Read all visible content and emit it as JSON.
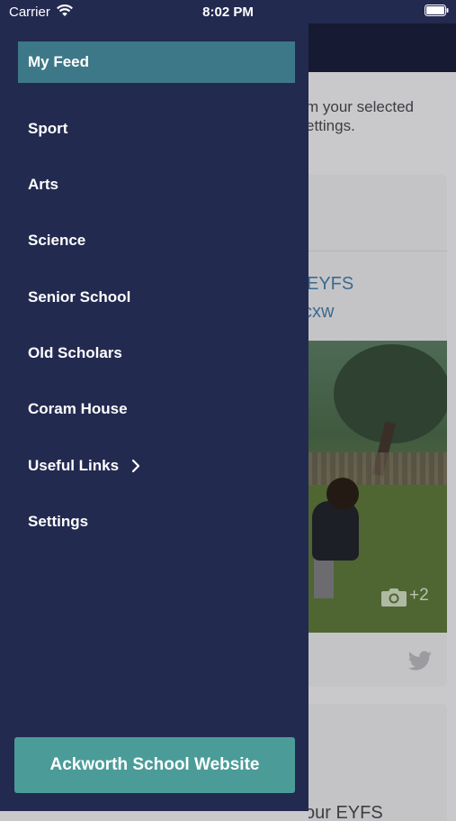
{
  "status_bar": {
    "carrier": "Carrier",
    "time": "8:02 PM"
  },
  "drawer": {
    "items": [
      {
        "label": "My Feed",
        "active": true
      },
      {
        "label": "Sport"
      },
      {
        "label": "Arts"
      },
      {
        "label": "Science"
      },
      {
        "label": "Senior School"
      },
      {
        "label": "Old Scholars"
      },
      {
        "label": "Coram House"
      },
      {
        "label": "Useful Links",
        "icon": "chevron-right-icon"
      },
      {
        "label": "Settings"
      }
    ],
    "website_button_label": "Ackworth School Website"
  },
  "background": {
    "intro_line1": "m your selected",
    "intro_line2": "ettings.",
    "card": {
      "link_line1": "EYFS",
      "link_line2": "cxw",
      "photo_count": "+2",
      "source_icon": "twitter-icon"
    },
    "card2_fragment": "our EYFS"
  },
  "colors": {
    "drawer_bg": "#232a50",
    "active_item_bg": "#3d7888",
    "button_bg": "#4b9c98",
    "link": "#3c6a8f"
  }
}
